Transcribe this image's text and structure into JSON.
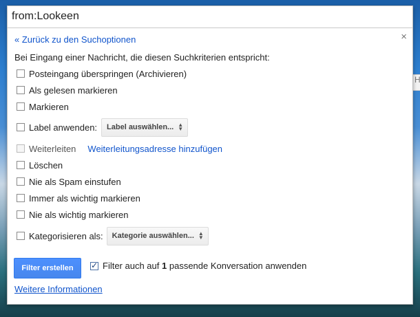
{
  "search": {
    "value": "from:Lookeen"
  },
  "close_symbol": "×",
  "back_link": "« Zurück zu den Suchoptionen",
  "intro": "Bei Eingang einer Nachricht, die diesen Suchkriterien entspricht:",
  "options": [
    {
      "label": "Posteingang überspringen (Archivieren)"
    },
    {
      "label": "Als gelesen markieren"
    },
    {
      "label": "Markieren"
    },
    {
      "label": "Label anwenden:",
      "select": "Label auswählen..."
    },
    {
      "label": "Weiterleiten",
      "link": "Weiterleitungsadresse hinzufügen",
      "disabled": true
    },
    {
      "label": "Löschen"
    },
    {
      "label": "Nie als Spam einstufen"
    },
    {
      "label": "Immer als wichtig markieren"
    },
    {
      "label": "Nie als wichtig markieren"
    },
    {
      "label": "Kategorisieren als:",
      "select": "Kategorie auswählen..."
    }
  ],
  "create_button": "Filter erstellen",
  "apply": {
    "prefix": "Filter auch auf",
    "count": "1",
    "suffix": "passende Konversation anwenden",
    "checked": true
  },
  "more_info": "Weitere Informationen",
  "side_tab": "H"
}
